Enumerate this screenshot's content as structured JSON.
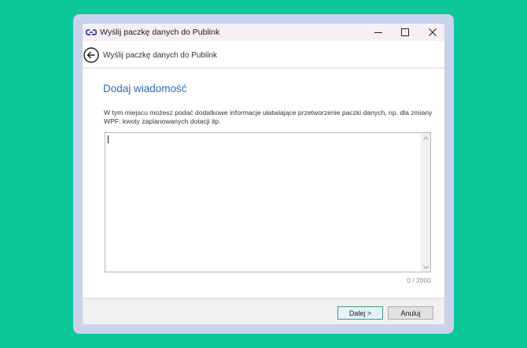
{
  "window": {
    "title": "Wyślij paczkę danych do Publink",
    "app_icon": "link-icon",
    "controls": [
      "minimize-icon",
      "maximize-icon",
      "close-icon"
    ]
  },
  "header": {
    "back_icon": "arrow-left-circle-icon",
    "title": "Wyślij paczkę danych do Publink"
  },
  "content": {
    "section_title": "Dodaj wiadomość",
    "description": "W tym miejscu możesz podać dodatkowe informacje ułatwiające przetworzenie paczki danych, np. dla zmiany WPF: kwoty zaplanowanych dotacji itp.",
    "message_value": "",
    "char_counter": "0 / 2000"
  },
  "footer": {
    "next_label": "Dalej >",
    "cancel_label": "Anuluj"
  },
  "colors": {
    "background": "#0cc898",
    "accent_title": "#2b6fb5",
    "default_button_border": "#4aa37a"
  }
}
